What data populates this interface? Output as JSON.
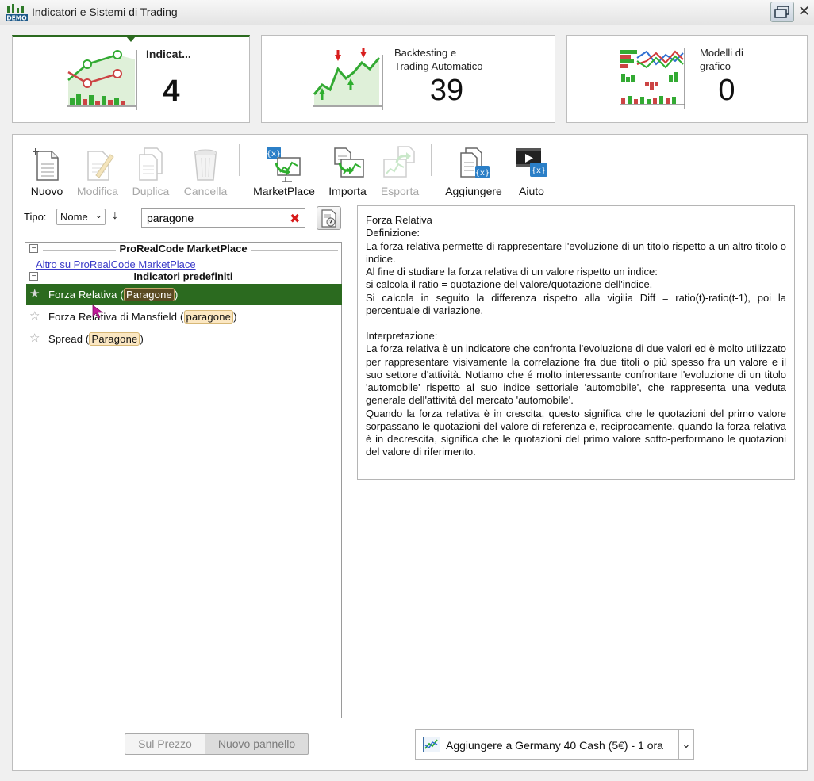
{
  "window": {
    "title": "Indicatori e Sistemi di Trading"
  },
  "cards": [
    {
      "label": "Indicat...",
      "count": "4"
    },
    {
      "label_line1": "Backtesting e",
      "label_line2": "Trading Automatico",
      "count": "39"
    },
    {
      "label_line1": "Modelli di",
      "label_line2": "grafico",
      "count": "0"
    }
  ],
  "toolbar": {
    "new": "Nuovo",
    "edit": "Modifica",
    "duplicate": "Duplica",
    "delete": "Cancella",
    "marketplace": "MarketPlace",
    "import": "Importa",
    "export": "Esporta",
    "add": "Aggiungere",
    "help": "Aiuto"
  },
  "filter": {
    "type_label": "Tipo:",
    "type_value": "Nome",
    "search_value": "paragone"
  },
  "list": {
    "group1_title": "ProRealCode MarketPlace",
    "group1_link": "Altro su ProRealCode MarketPlace",
    "group2_title": "Indicatori predefiniti",
    "items": [
      {
        "pre": "Forza Relativa (",
        "hl": "Paragone",
        "post": ")"
      },
      {
        "pre": "Forza Relativa di Mansfield (",
        "hl": "paragone",
        "post": ")"
      },
      {
        "pre": "Spread (",
        "hl": "Paragone",
        "post": ")"
      }
    ]
  },
  "description": {
    "title": "Forza Relativa",
    "def_heading": "Definizione:",
    "def_p1": "La forza relativa permette di rappresentare l'evoluzione di un titolo rispetto a un altro titolo o indice.",
    "def_p2": "Al fine di studiare la forza relativa di un valore rispetto un indice:",
    "def_p3": "si calcola il ratio = quotazione del valore/quotazione dell'indice.",
    "def_p4": "Si calcola in seguito la differenza rispetto alla vigilia Diff = ratio(t)-ratio(t-1), poi la percentuale di variazione.",
    "int_heading": "Interpretazione:",
    "int_p1": "La forza relativa è un indicatore che confronta l'evoluzione di due valori ed è molto utilizzato per rappresentare visivamente la correlazione fra due titoli o più spesso fra un valore e il suo settore d'attività. Notiamo che é molto interessante confrontare l'evoluzione di un titolo 'automobile' rispetto al suo indice settoriale 'automobile', che rappresenta una veduta generale dell'attività del mercato 'automobile'.",
    "int_p2": "Quando la forza relativa è in crescita, questo significa che le quotazioni del primo valore sorpassano le quotazioni del valore di referenza e, reciprocamente, quando la forza relativa è in decrescita, significa che le quotazioni del primo valore sotto-performano le quotazioni del valore di riferimento."
  },
  "bottom": {
    "on_price": "Sul Prezzo",
    "new_panel": "Nuovo pannello",
    "add_to": "Aggiungere a Germany 40 Cash (5€) - 1 ora"
  },
  "colors": {
    "accent_green": "#2b6a1f",
    "highlight": "#fbe7c2",
    "link": "#3a3ac8"
  },
  "icons": {
    "logo": "demo-logo-icon",
    "restore": "restore-window-icon",
    "close": "close-icon"
  }
}
